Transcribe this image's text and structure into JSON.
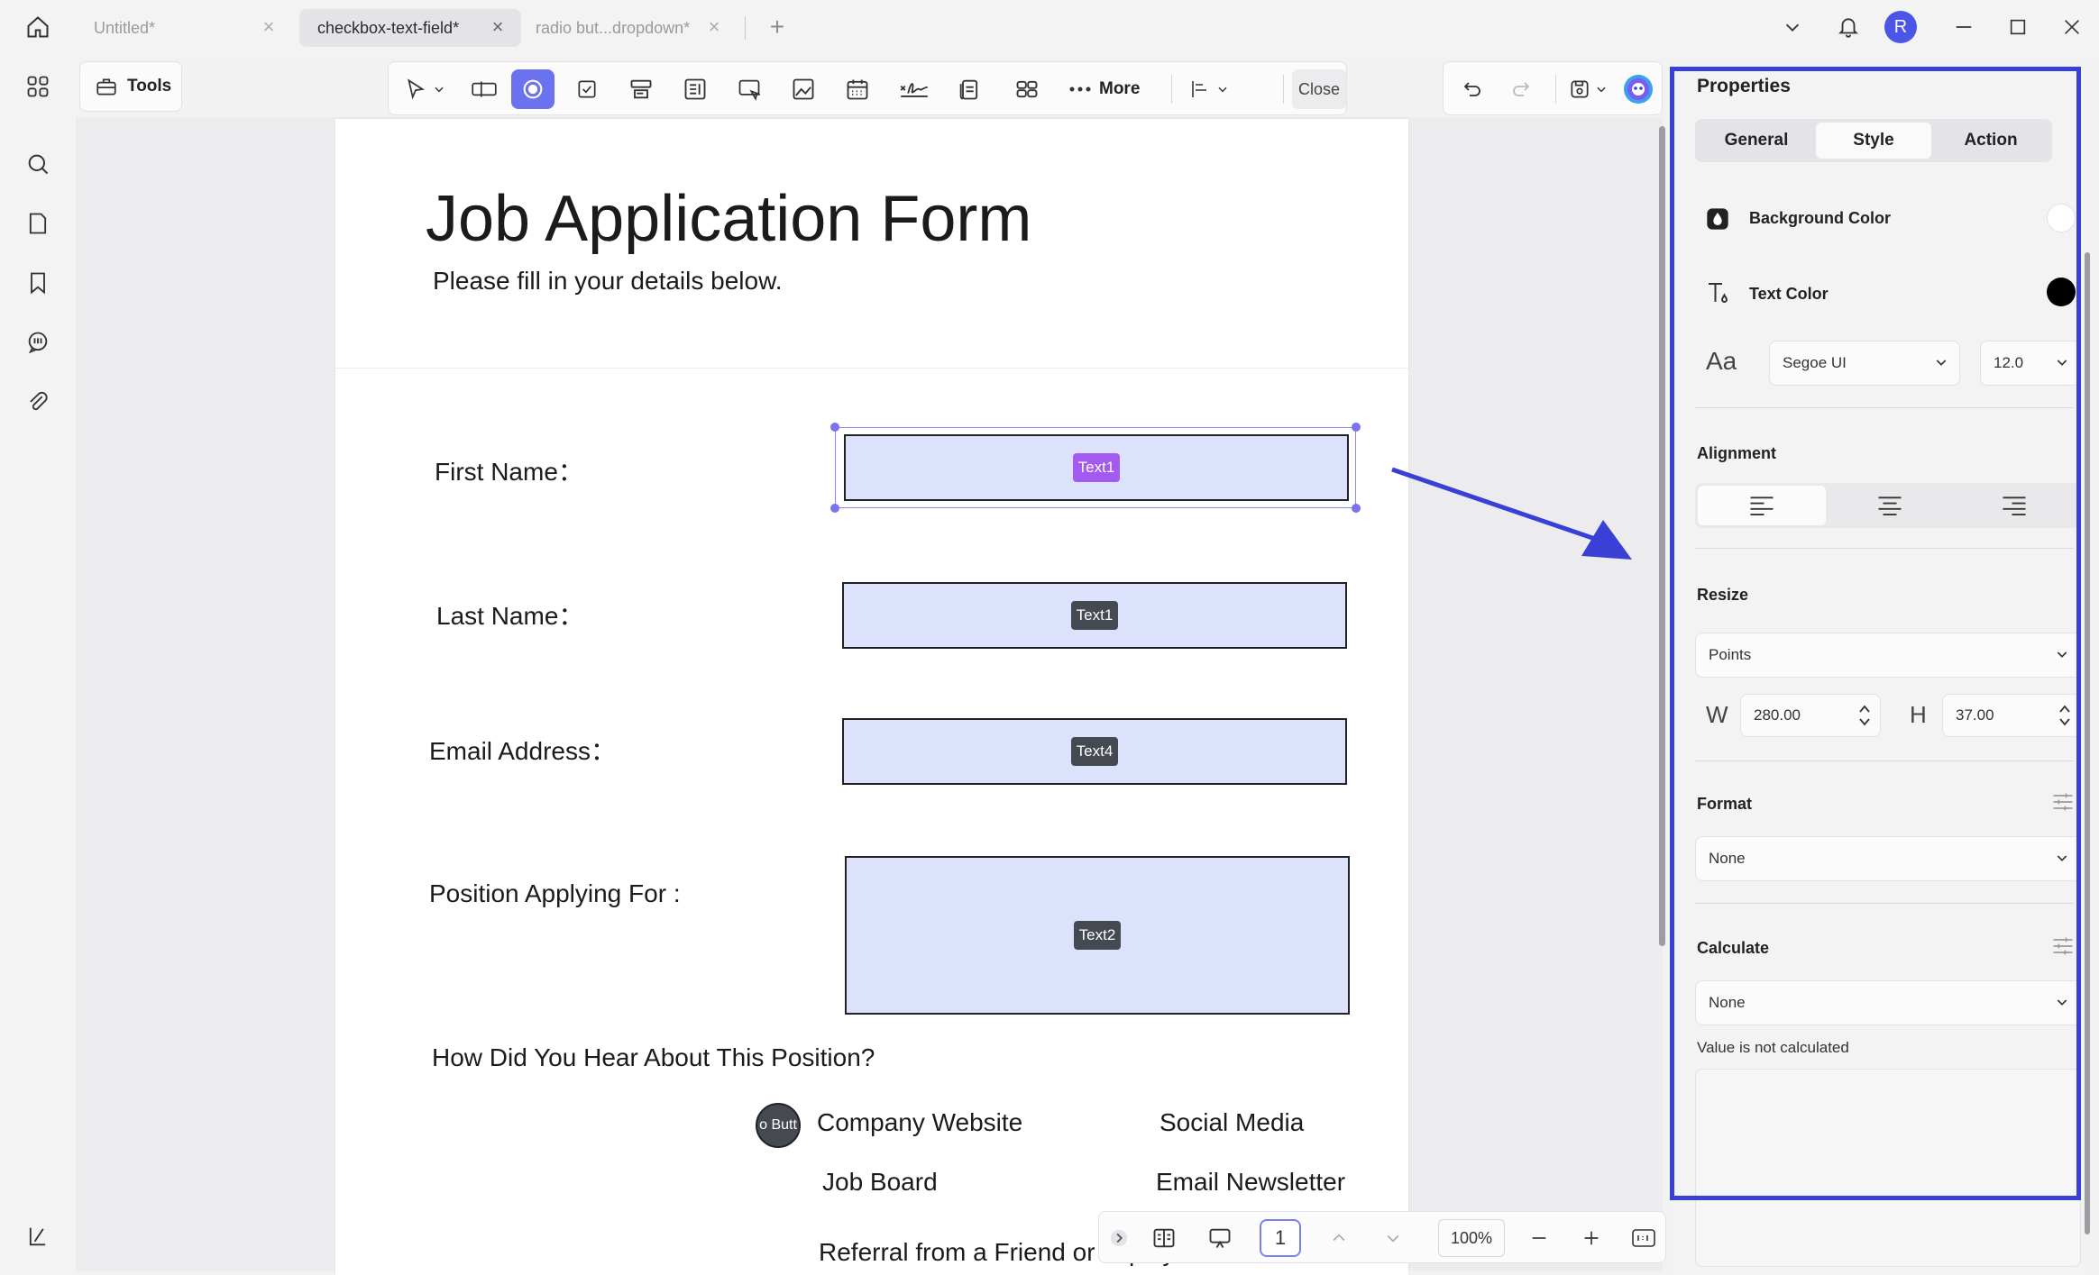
{
  "tabs": [
    {
      "label": "Untitled*",
      "active": false
    },
    {
      "label": "checkbox-text-field*",
      "active": true
    },
    {
      "label": "radio but...dropdown*",
      "active": false
    }
  ],
  "user": {
    "avatar_letter": "R"
  },
  "toolbar": {
    "tools_label": "Tools",
    "more_label": "More",
    "close_label": "Close"
  },
  "document": {
    "title": "Job Application Form",
    "subtitle": "Please fill in your details below.",
    "fields": [
      {
        "label": "First Name：",
        "tag": "Text1"
      },
      {
        "label": "Last Name：",
        "tag": "Text1"
      },
      {
        "label": "Email Address：",
        "tag": "Text4"
      },
      {
        "label": "Position Applying For :",
        "tag": "Text2"
      }
    ],
    "question": "How Did You Hear About This Position?",
    "radio_widget_text": "o Butt",
    "options": [
      "Company Website",
      "Social Media",
      "Job Board",
      "Email Newsletter",
      "Referral from a Friend or"
    ],
    "options_tail": "ploy"
  },
  "bottombar": {
    "page": "1",
    "zoom": "100%"
  },
  "properties": {
    "title": "Properties",
    "tabs": [
      "General",
      "Style",
      "Action"
    ],
    "active_tab": "Style",
    "background_color_label": "Background Color",
    "background_color": "#ffffff",
    "text_color_label": "Text Color",
    "text_color": "#000000",
    "font_icon_text": "Aa",
    "font": "Segoe UI",
    "font_size": "12.0",
    "alignment_label": "Alignment",
    "resize_label": "Resize",
    "resize_unit": "Points",
    "width_letter": "W",
    "width": "280.00",
    "height_letter": "H",
    "height": "37.00",
    "format_label": "Format",
    "format_value": "None",
    "calculate_label": "Calculate",
    "calculate_value": "None",
    "calculate_note": "Value is not calculated"
  },
  "colors": {
    "accent": "#6b72f0",
    "highlight": "#3a3fd6",
    "field_fill": "#dde2fc",
    "active_tag": "#a35af0"
  }
}
